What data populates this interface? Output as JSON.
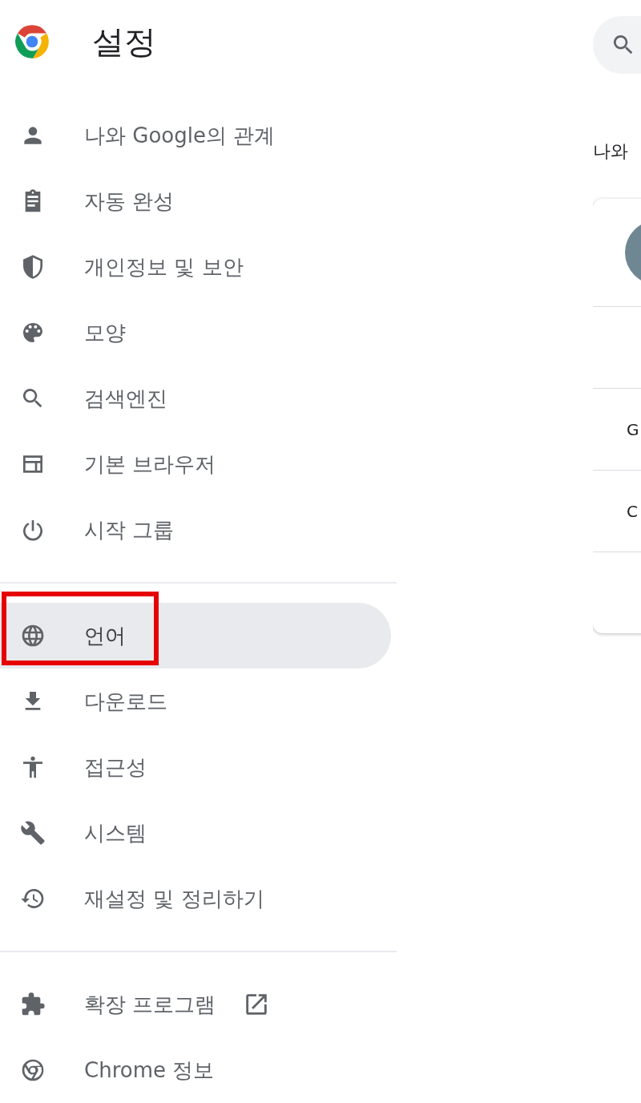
{
  "header": {
    "title": "설정"
  },
  "sidebar": {
    "groups": [
      {
        "items": [
          {
            "label": "나와 Google의 관계",
            "selected": false
          },
          {
            "label": "자동 완성",
            "selected": false
          },
          {
            "label": "개인정보 및 보안",
            "selected": false
          },
          {
            "label": "모양",
            "selected": false
          },
          {
            "label": "검색엔진",
            "selected": false
          },
          {
            "label": "기본 브라우저",
            "selected": false
          },
          {
            "label": "시작 그룹",
            "selected": false
          }
        ]
      },
      {
        "items": [
          {
            "label": "언어",
            "selected": true,
            "annotated": true
          },
          {
            "label": "다운로드",
            "selected": false,
            "annotated": false
          },
          {
            "label": "접근성",
            "selected": false,
            "annotated": false
          },
          {
            "label": "시스템",
            "selected": false,
            "annotated": false
          },
          {
            "label": "재설정 및 정리하기",
            "selected": false,
            "annotated": false
          }
        ]
      },
      {
        "items": [
          {
            "label": "확장 프로그램",
            "selected": false,
            "external": true
          },
          {
            "label": "Chrome 정보",
            "selected": false,
            "external": false
          }
        ]
      }
    ]
  },
  "main": {
    "section_title": "나와",
    "card_rows": [
      {
        "label": ""
      },
      {
        "label": ""
      },
      {
        "label": "G"
      },
      {
        "label": "C"
      },
      {
        "label": ""
      }
    ]
  }
}
